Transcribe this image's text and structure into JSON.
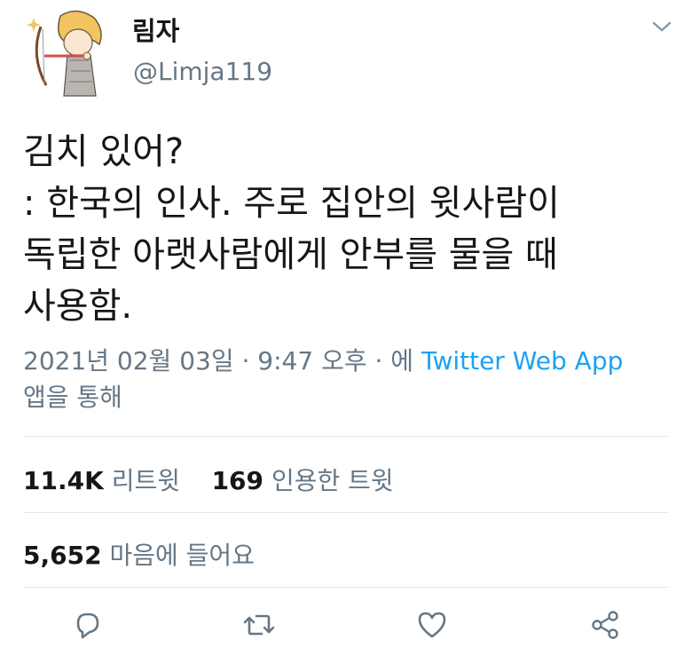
{
  "author": {
    "display_name": "림자",
    "handle": "@Limja119"
  },
  "tweet": {
    "lines": [
      "김치 있어?",
      ": 한국의 인사. 주로 집안의 윗사람이",
      "독립한 아랫사람에게 안부를 물을 때",
      "사용함."
    ]
  },
  "meta": {
    "timestamp": "2021년 02월 03일 · 9:47 오후 · 에",
    "source": "Twitter Web App",
    "via_suffix": "앱을 통해"
  },
  "stats": {
    "retweets_count": "11.4K",
    "retweets_label": "리트윗",
    "quotes_count": "169",
    "quotes_label": "인용한 트윗",
    "likes_count": "5,652",
    "likes_label": "마음에 들어요"
  },
  "icons": {
    "caret": "chevron-down-icon",
    "reply": "reply-icon",
    "retweet": "retweet-icon",
    "like": "heart-icon",
    "share": "share-icon"
  },
  "colors": {
    "text": "#14171a",
    "secondary": "#657786",
    "link": "#1da1f2",
    "divider": "#e1e8ed"
  }
}
